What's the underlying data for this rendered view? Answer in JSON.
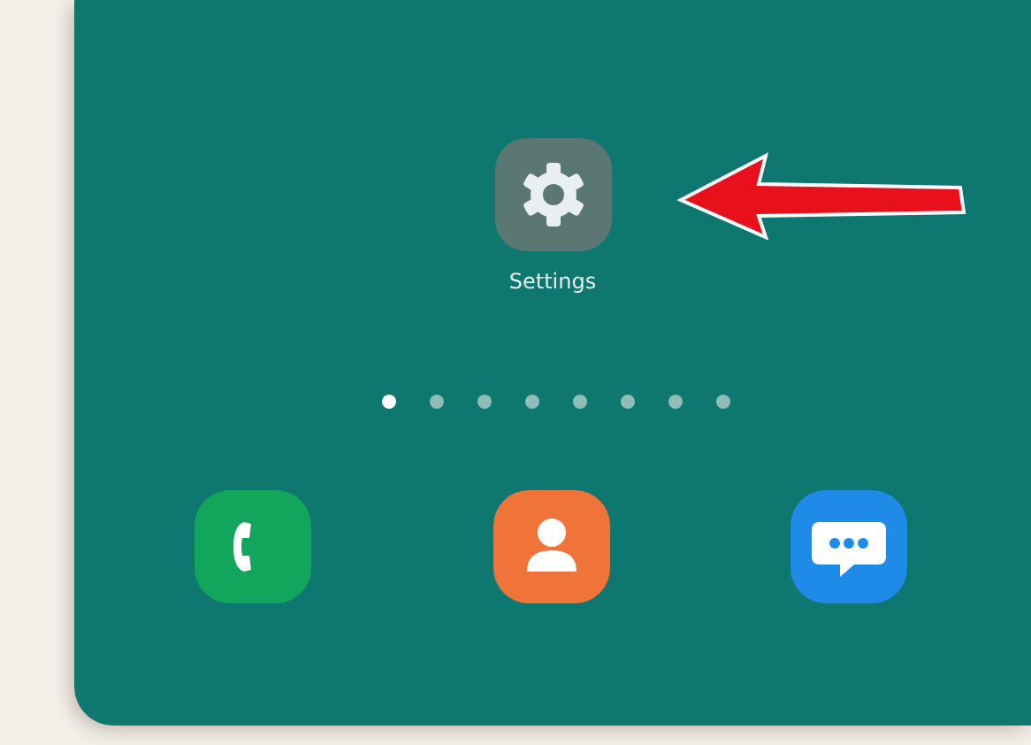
{
  "apps": [
    {
      "kind": "settings",
      "label": "Settings"
    }
  ],
  "page_dots": [
    {
      "selected": true
    },
    {
      "selected": false
    },
    {
      "selected": false
    },
    {
      "selected": false
    },
    {
      "selected": false
    },
    {
      "selected": false
    },
    {
      "selected": false
    },
    {
      "selected": false
    }
  ],
  "dock": [
    {
      "kind": "phone"
    },
    {
      "kind": "contacts"
    },
    {
      "kind": "messages"
    }
  ]
}
